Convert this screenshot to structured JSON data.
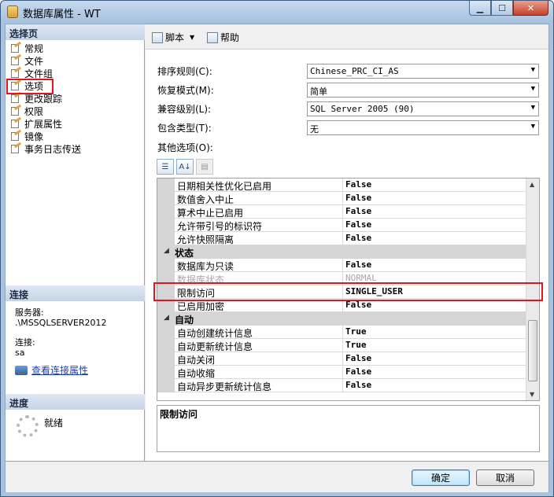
{
  "window": {
    "title": "数据库属性 - WT"
  },
  "caption_buttons": {
    "minimize": "▁",
    "maximize": "☐",
    "close": "✕"
  },
  "left": {
    "select_page_header": "选择页",
    "pages": [
      "常规",
      "文件",
      "文件组",
      "选项",
      "更改跟踪",
      "权限",
      "扩展属性",
      "镜像",
      "事务日志传送"
    ],
    "selected_page": "选项",
    "connection_header": "连接",
    "server_label": "服务器:",
    "server_value": ".\\MSSQLSERVER2012",
    "conn_label": "连接:",
    "conn_value": "sa",
    "view_conn_link": "查看连接属性",
    "progress_header": "进度",
    "progress_status": "就绪"
  },
  "toolbar": {
    "script_label": "脚本",
    "help_label": "帮助"
  },
  "form": {
    "collation_label": "排序规则(C):",
    "collation_value": "Chinese_PRC_CI_AS",
    "recovery_label": "恢复模式(M):",
    "recovery_value": "简单",
    "compat_label": "兼容级别(L):",
    "compat_value": "SQL Server 2005 (90)",
    "containment_label": "包含类型(T):",
    "containment_value": "无",
    "other_options_label": "其他选项(O):"
  },
  "grid": {
    "rows_top": [
      {
        "name": "日期相关性优化已启用",
        "value": "False"
      },
      {
        "name": "数值舍入中止",
        "value": "False"
      },
      {
        "name": "算术中止已启用",
        "value": "False"
      },
      {
        "name": "允许带引号的标识符",
        "value": "False"
      },
      {
        "name": "允许快照隔离",
        "value": "False"
      }
    ],
    "cat_state": "状态",
    "rows_state": [
      {
        "name": "数据库为只读",
        "value": "False"
      },
      {
        "name": "数据库状态",
        "value": "NORMAL"
      },
      {
        "name": "限制访问",
        "value": "SINGLE_USER"
      },
      {
        "name": "已启用加密",
        "value": "False"
      }
    ],
    "cat_auto": "自动",
    "rows_auto": [
      {
        "name": "自动创建统计信息",
        "value": "True"
      },
      {
        "name": "自动更新统计信息",
        "value": "True"
      },
      {
        "name": "自动关闭",
        "value": "False"
      },
      {
        "name": "自动收缩",
        "value": "False"
      },
      {
        "name": "自动异步更新统计信息",
        "value": "False"
      }
    ]
  },
  "description": {
    "title": "限制访问"
  },
  "footer": {
    "ok_label": "确定",
    "cancel_label": "取消"
  },
  "colors": {
    "highlight": "#e0161c",
    "section_header": "#c5d4e6",
    "category_bg": "#d5d5d5"
  }
}
